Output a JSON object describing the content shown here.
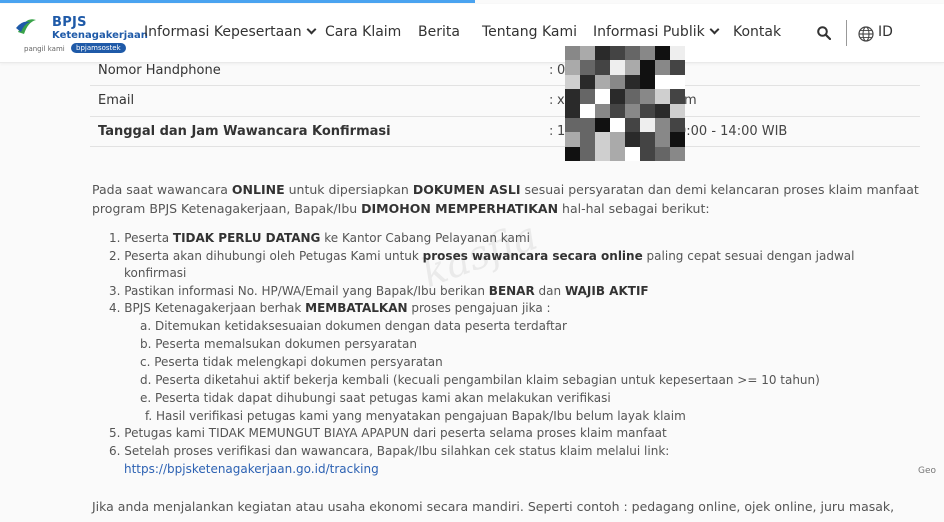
{
  "header": {
    "logo": {
      "title": "BPJS",
      "subtitle": "Ketenagakerjaan",
      "tagline": "pangil kami",
      "badge": "bpjamsostek"
    },
    "nav": [
      {
        "label": "Informasi Kepesertaan",
        "dropdown": true
      },
      {
        "label": "Cara Klaim",
        "dropdown": false
      },
      {
        "label": "Berita",
        "dropdown": false
      },
      {
        "label": "Tentang Kami",
        "dropdown": false
      },
      {
        "label": "Informasi Publik",
        "dropdown": true
      },
      {
        "label": "Kontak",
        "dropdown": false
      }
    ],
    "language": "ID",
    "search_icon": "search-icon",
    "globe_icon": "globe-icon",
    "colors": {
      "brand": "#1f5aa8",
      "accent": "#3aa34a",
      "link": "#2d62b3"
    }
  },
  "details": [
    {
      "label": "Nomor Handphone",
      "value_start": "0",
      "value_end": ""
    },
    {
      "label": "Email",
      "value_start": "x",
      "value_end": "m"
    },
    {
      "label": "Tanggal dan Jam Wawancara Konfirmasi",
      "value_start": "1",
      "value_end": "0:00 - 14:00 WIB"
    }
  ],
  "content": {
    "intro": {
      "p1": "Pada saat wawancara ",
      "b1": "ONLINE",
      "p2": " untuk dipersiapkan ",
      "b2": "DOKUMEN ASLI",
      "p3": " sesuai persyaratan dan demi kelancaran proses klaim manfaat",
      "p4": "program BPJS Ketenagakerjaan, Bapak/Ibu ",
      "b3": "DIMOHON MEMPERHATIKAN",
      "p5": " hal-hal sebagai berikut:"
    },
    "items": {
      "i1a": "1. Peserta ",
      "i1b": "TIDAK PERLU DATANG",
      "i1c": " ke Kantor Cabang Pelayanan kami",
      "i2a": "2. Peserta akan dihubungi oleh Petugas Kami untuk ",
      "i2b": "proses wawancara secara online",
      "i2c": " paling cepat sesuai dengan jadwal",
      "i2d": "konfirmasi",
      "i3a": "3. Pastikan informasi No. HP/WA/Email yang Bapak/Ibu berikan ",
      "i3b": "BENAR",
      "i3c": " dan ",
      "i3d": "WAJIB AKTIF",
      "i4a": "4. BPJS Ketenagakerjaan berhak ",
      "i4b": "MEMBATALKAN",
      "i4c": " proses pengajuan jika :",
      "sa": "a. Ditemukan ketidaksesuaian dokumen dengan data peserta terdaftar",
      "sb": "b. Peserta memalsukan dokumen persyaratan",
      "sc": "c. Peserta tidak melengkapi dokumen persyaratan",
      "sd": "d. Peserta diketahui aktif bekerja kembali (kecuali pengambilan klaim sebagian untuk kepesertaan >= 10 tahun)",
      "se": "e. Peserta tidak dapat dihubungi saat petugas kami akan melakukan verifikasi",
      "sf": "f. Hasil verifikasi petugas kami yang menyatakan pengajuan Bapak/Ibu belum layak klaim",
      "i5": "5. Petugas kami TIDAK MEMUNGUT BIAYA APAPUN dari peserta selama proses klaim manfaat",
      "i6": "6. Setelah proses verifikasi dan wawancara, Bapak/Ibu silahkan cek status klaim melalui link:",
      "link": "https://bpjsketenagakerjaan.go.id/tracking"
    },
    "footer_text": "Jika anda menjalankan kegiatan atau usaha ekonomi secara mandiri. Seperti contoh : pedagang online, ojek online, juru masak,",
    "watermark": "kasfia",
    "side_mark": "Geo"
  }
}
